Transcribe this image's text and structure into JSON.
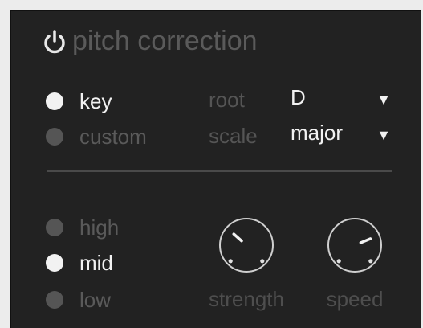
{
  "header": {
    "title": "pitch correction",
    "power_icon": "power-icon"
  },
  "mode": {
    "options": [
      {
        "label": "key",
        "selected": true
      },
      {
        "label": "custom",
        "selected": false
      }
    ]
  },
  "root": {
    "label": "root",
    "value": "D",
    "caret_icon": "caret-down-icon",
    "caret": "▼"
  },
  "scale": {
    "label": "scale",
    "value": "major",
    "caret_icon": "caret-down-icon",
    "caret": "▼"
  },
  "range": {
    "options": [
      {
        "label": "high",
        "selected": false
      },
      {
        "label": "mid",
        "selected": true
      },
      {
        "label": "low",
        "selected": false
      }
    ]
  },
  "knobs": [
    {
      "label": "strength",
      "value": 0.32
    },
    {
      "label": "speed",
      "value": 0.75
    }
  ],
  "colors": {
    "panel_bg": "#222222",
    "active": "#f2f2f2",
    "inactive": "#555555",
    "dim_text": "#5a5a5a"
  }
}
